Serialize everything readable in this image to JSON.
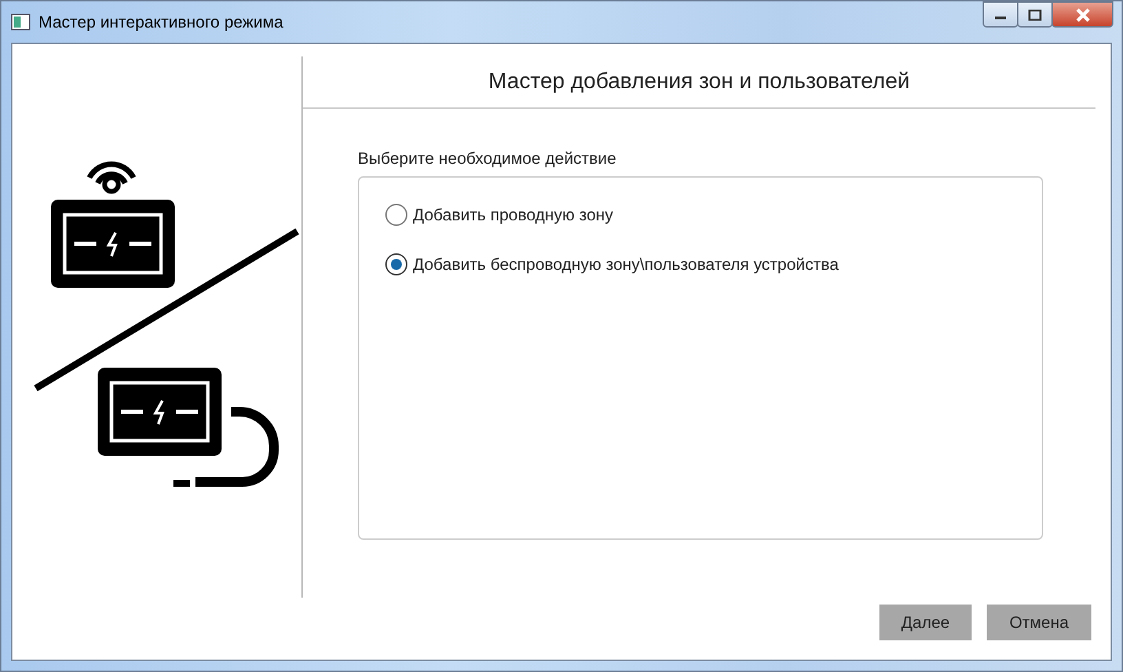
{
  "window": {
    "title": "Мастер интерактивного режима"
  },
  "header": {
    "title": "Мастер добавления зон и пользователей"
  },
  "prompt": "Выберите необходимое действие",
  "options": [
    {
      "label": "Добавить проводную зону",
      "selected": false
    },
    {
      "label": "Добавить беспроводную зону\\пользователя устройства",
      "selected": true
    }
  ],
  "buttons": [
    {
      "label": "Далее"
    },
    {
      "label": "Отмена"
    }
  ]
}
